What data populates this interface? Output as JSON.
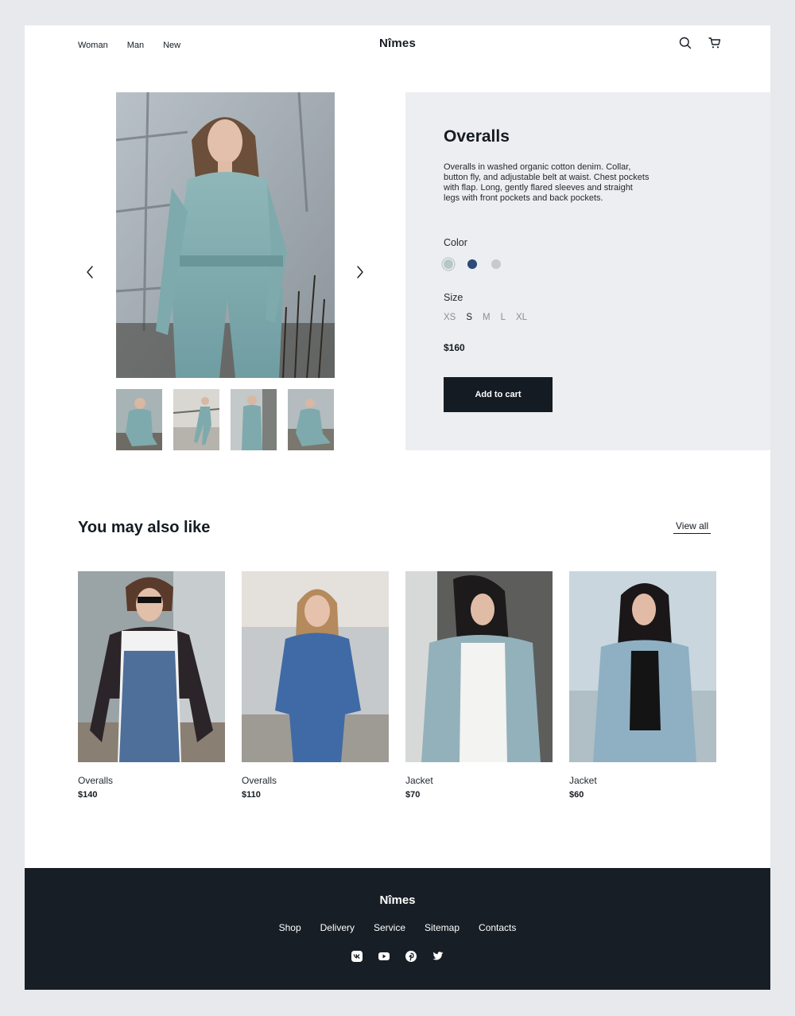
{
  "header": {
    "logo": "Nîmes",
    "nav": [
      {
        "label": "Woman"
      },
      {
        "label": "Man"
      },
      {
        "label": "New"
      }
    ],
    "icons": [
      "search-icon",
      "cart-icon"
    ]
  },
  "product": {
    "title": "Overalls",
    "description": "Overalls in washed organic cotton denim. Collar, button fly, and adjustable belt at waist. Chest pockets with flap. Long, gently flared sleeves and straight legs with front pockets and back pockets.",
    "color_label": "Color",
    "colors": [
      "#b7c7c6",
      "#2c4a7a",
      "#c7c9cc"
    ],
    "selected_color_index": 0,
    "size_label": "Size",
    "sizes": [
      "XS",
      "S",
      "M",
      "L",
      "XL"
    ],
    "selected_size": "S",
    "price": "$160",
    "add_to_cart": "Add to cart"
  },
  "recommendations": {
    "title": "You may also like",
    "view_all": "View all",
    "items": [
      {
        "name": "Overalls",
        "price": "$140"
      },
      {
        "name": "Overalls",
        "price": "$110"
      },
      {
        "name": "Jacket",
        "price": "$70"
      },
      {
        "name": "Jacket",
        "price": "$60"
      }
    ]
  },
  "footer": {
    "logo": "Nîmes",
    "links": [
      {
        "label": "Shop"
      },
      {
        "label": "Delivery"
      },
      {
        "label": "Service"
      },
      {
        "label": "Sitemap"
      },
      {
        "label": "Contacts"
      }
    ],
    "social_icons": [
      "vk-icon",
      "youtube-icon",
      "pinterest-icon",
      "twitter-icon"
    ]
  }
}
